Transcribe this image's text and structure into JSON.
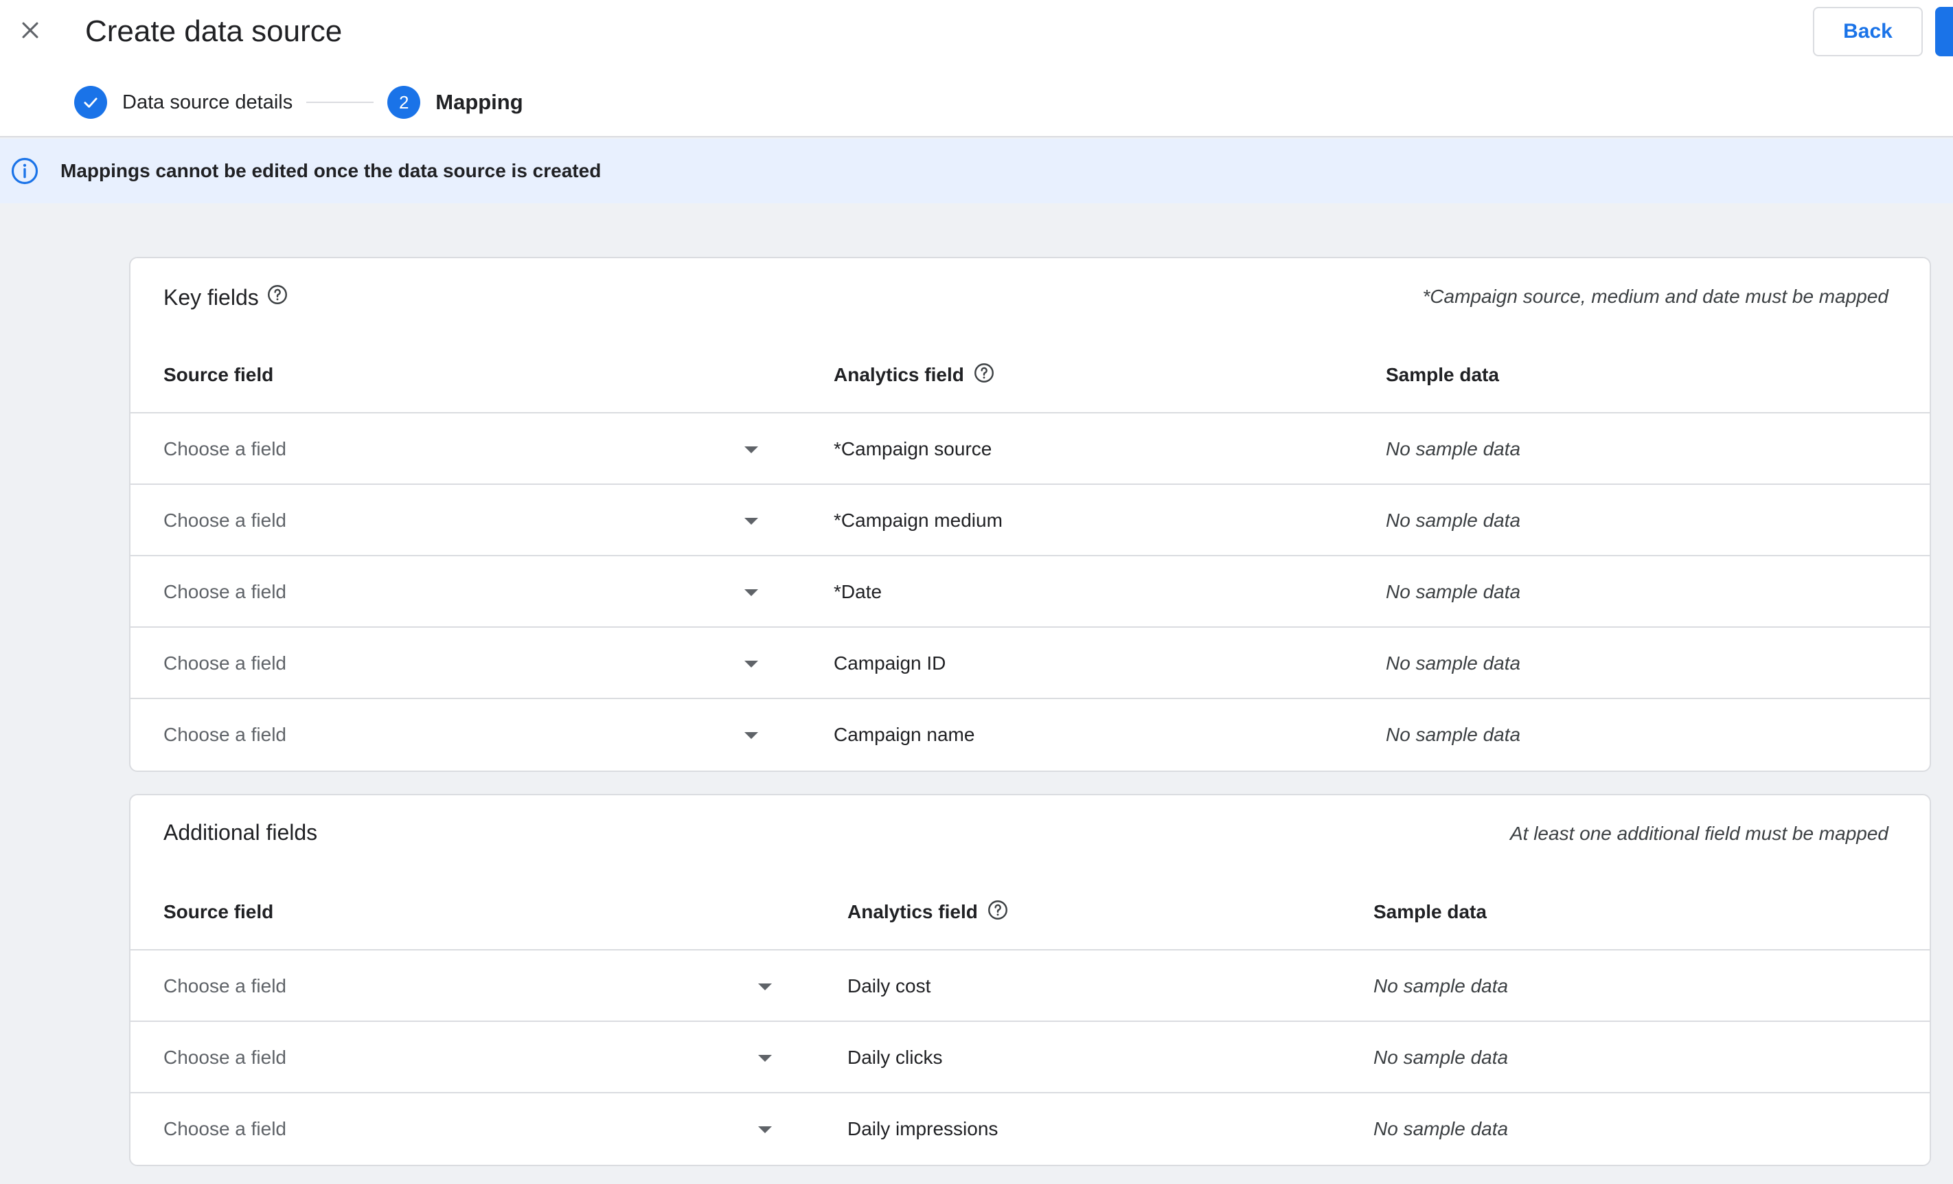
{
  "header": {
    "title": "Create data source",
    "back_label": "Back",
    "close_icon": "close-icon"
  },
  "stepper": {
    "steps": [
      {
        "label": "Data source details",
        "status": "complete",
        "icon": "check-icon"
      },
      {
        "label": "Mapping",
        "status": "active",
        "number": "2"
      }
    ]
  },
  "banner": {
    "icon": "info-icon",
    "text": "Mappings cannot be edited once the data source is created"
  },
  "key_fields": {
    "title": "Key fields",
    "note": "*Campaign source, medium and date must be mapped",
    "columns": {
      "source": "Source field",
      "analytics": "Analytics field",
      "sample": "Sample data"
    },
    "rows": [
      {
        "placeholder": "Choose a field",
        "analytics_field": "*Campaign source",
        "sample": "No sample data"
      },
      {
        "placeholder": "Choose a field",
        "analytics_field": "*Campaign medium",
        "sample": "No sample data"
      },
      {
        "placeholder": "Choose a field",
        "analytics_field": "*Date",
        "sample": "No sample data"
      },
      {
        "placeholder": "Choose a field",
        "analytics_field": "Campaign ID",
        "sample": "No sample data"
      },
      {
        "placeholder": "Choose a field",
        "analytics_field": "Campaign name",
        "sample": "No sample data"
      }
    ]
  },
  "additional_fields": {
    "title": "Additional fields",
    "note": "At least one additional field must be mapped",
    "columns": {
      "source": "Source field",
      "analytics": "Analytics field",
      "sample": "Sample data"
    },
    "rows": [
      {
        "placeholder": "Choose a field",
        "analytics_field": "Daily cost",
        "sample": "No sample data"
      },
      {
        "placeholder": "Choose a field",
        "analytics_field": "Daily clicks",
        "sample": "No sample data"
      },
      {
        "placeholder": "Choose a field",
        "analytics_field": "Daily impressions",
        "sample": "No sample data"
      }
    ]
  },
  "colors": {
    "accent": "#1a73e8",
    "banner_bg": "#e8f0fe",
    "page_bg": "#eff1f4"
  }
}
